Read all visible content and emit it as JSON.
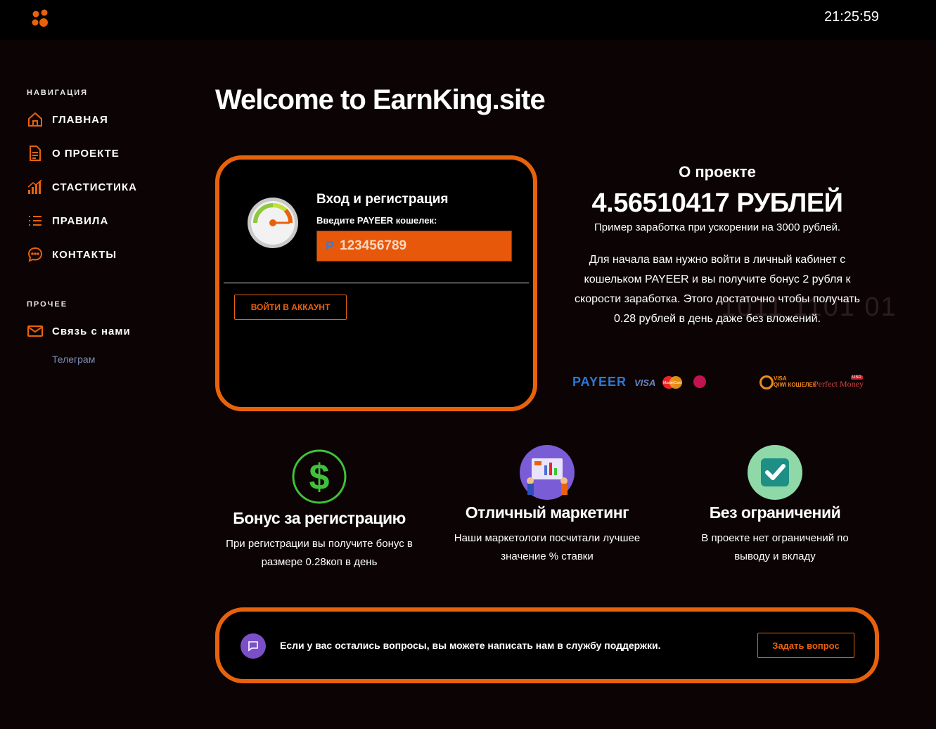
{
  "header": {
    "clock": "21:25:59"
  },
  "sidebar": {
    "nav_heading": "НАВИГАЦИЯ",
    "nav_items": [
      {
        "label": "ГЛАВНАЯ",
        "icon": "home-icon"
      },
      {
        "label": "О ПРОЕКТЕ",
        "icon": "document-icon"
      },
      {
        "label": "СТАСТИСТИКА",
        "icon": "chart-icon"
      },
      {
        "label": "ПРАВИЛА",
        "icon": "list-icon"
      },
      {
        "label": "КОНТАКТЫ",
        "icon": "chat-icon"
      }
    ],
    "other_heading": "ПРОЧЕЕ",
    "contact_item": {
      "label": "Связь с нами",
      "icon": "mail-icon"
    },
    "telegram_link": "Телеграм"
  },
  "main": {
    "title": "Welcome to EarnKing.site",
    "login": {
      "title": "Вход и регистрация",
      "subtitle": "Введите PAYEER кошелек:",
      "wallet_prefix": "P",
      "wallet_value": "123456789",
      "button": "ВОЙТИ В АККАУНТ"
    },
    "about": {
      "title": "О проекте",
      "amount": "4.56510417 РУБЛЕЙ",
      "example": "Пример заработка при ускорении на 3000 рублей.",
      "text": "Для начала вам нужно войти в личный кабинет с кошельком PAYEER и вы получите бонус 2 рубля к скорости заработка. Этого достаточно чтобы получать 0.28 рублей в день даже без вложений."
    },
    "payment_logos": {
      "payeer": "PAYEER",
      "visa": "VISA",
      "mastercard": "MasterCard",
      "qiwi_top": "VISA",
      "qiwi_bottom": "QIWI КОШЕЛЕК",
      "perfect_money": "Perfect Money",
      "usd": "USD"
    },
    "features": [
      {
        "title": "Бонус за регистрацию",
        "desc": "При регистрации вы получите бонус в размере 0.28коп в день",
        "icon": "dollar-icon"
      },
      {
        "title": "Отличный маркетинг",
        "desc": "Наши маркетологи посчитали лучшее значение % ставки",
        "icon": "marketing-icon"
      },
      {
        "title": "Без ограничений",
        "desc": "В проекте нет ограничений по выводу и вкладу",
        "icon": "checkmark-icon"
      }
    ],
    "support": {
      "text": "Если у вас остались вопросы, вы можете написать нам в службу поддержки.",
      "button": "Задать вопрос"
    }
  },
  "colors": {
    "accent": "#e8620c",
    "background": "#0c0404",
    "link": "#7d8db3"
  }
}
